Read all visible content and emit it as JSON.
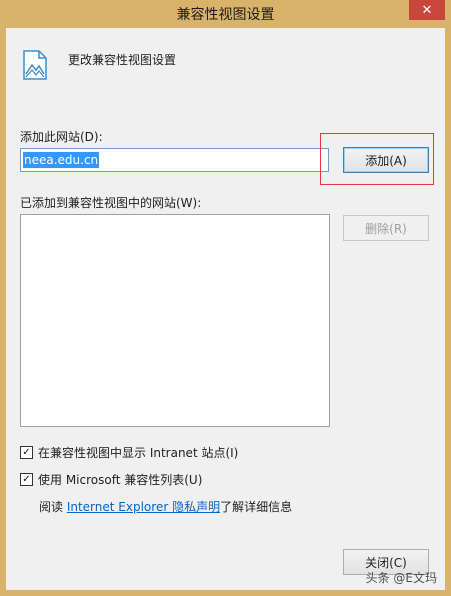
{
  "window": {
    "title": "兼容性视图设置",
    "close_glyph": "✕"
  },
  "header": {
    "icon": "document-mountain-icon",
    "text": "更改兼容性视图设置"
  },
  "add_site": {
    "label": "添加此网站(D):",
    "value": "neea.edu.cn",
    "button_label": "添加(A)"
  },
  "added_sites": {
    "label": "已添加到兼容性视图中的网站(W):",
    "items": [],
    "remove_label": "删除(R)"
  },
  "options": {
    "intranet": {
      "label": "在兼容性视图中显示 Intranet 站点(I)",
      "checked": true
    },
    "ms_list": {
      "label": "使用 Microsoft 兼容性列表(U)",
      "checked": true
    }
  },
  "info": {
    "prefix": "阅读 ",
    "link": "Internet Explorer 隐私声明",
    "suffix": "了解详细信息"
  },
  "footer": {
    "close_label": "关闭(C)"
  },
  "watermark": "头条 @E文玛",
  "colors": {
    "title_bar": "#d9b36b",
    "close_button": "#c9463d",
    "highlight_border": "#e0393e",
    "link": "#0066cc",
    "selection": "#3399ff"
  }
}
